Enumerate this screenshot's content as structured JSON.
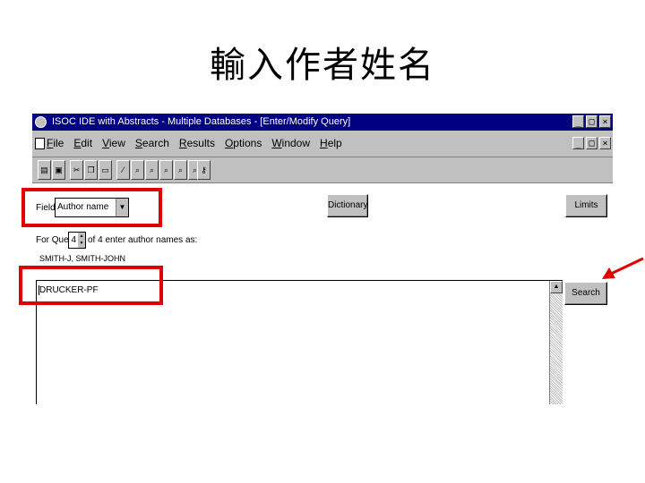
{
  "slide_title": "輸入作者姓名",
  "window": {
    "title": "ISOC IDE with Abstracts - Multiple Databases - [Enter/Modify Query]",
    "buttons": [
      "_",
      "□",
      "×"
    ],
    "doc_buttons": [
      "_",
      "□",
      "×"
    ]
  },
  "menu": {
    "items": [
      "File",
      "Edit",
      "View",
      "Search",
      "Results",
      "Options",
      "Window",
      "Help"
    ]
  },
  "toolbar": {
    "icons": [
      "printer-icon",
      "save-icon",
      "cut-icon",
      "copy-icon",
      "paste-icon",
      "magic-wand-icon",
      "find-icon",
      "format-icon",
      "sort-icon",
      "help-icon",
      "exit-icon",
      "info-icon"
    ]
  },
  "form": {
    "field_label": "Field",
    "field_value": "Author name",
    "for_query_label": "For Query",
    "query_number": "4",
    "query_suffix": "of 4  enter author names as:",
    "format_hint": "SMITH-J, SMITH-JOHN",
    "query_text": "DRUCKER-PF",
    "dictionary_label": "Dictionary",
    "limits_label": "Limits",
    "search_label": "Search"
  },
  "annotation": {
    "highlight_color": "#e00000"
  }
}
